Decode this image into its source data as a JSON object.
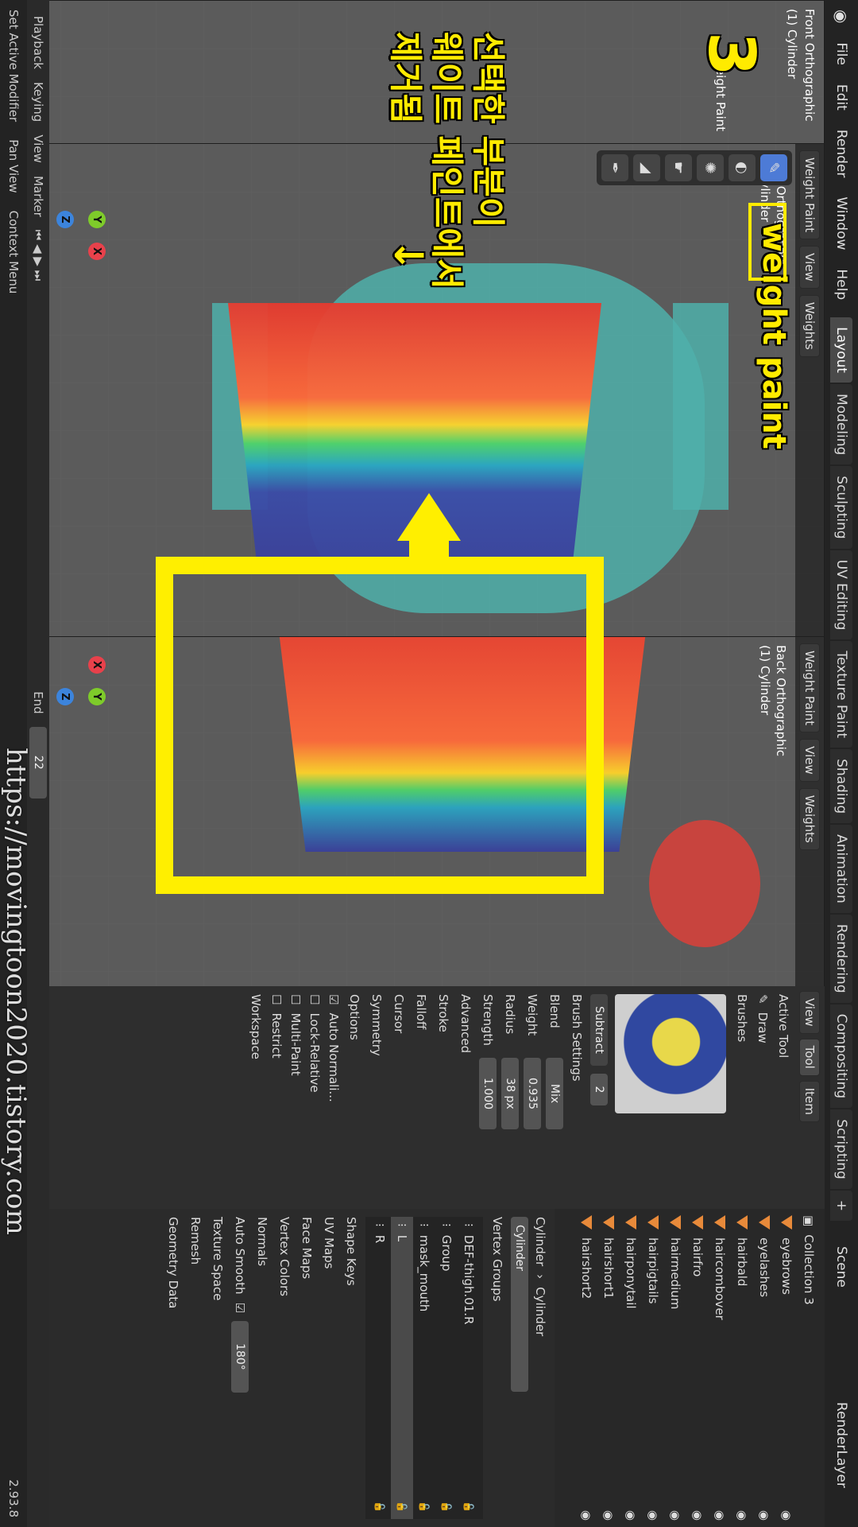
{
  "menu": [
    "File",
    "Edit",
    "Render",
    "Window",
    "Help"
  ],
  "workspaces": [
    "Layout",
    "Modeling",
    "Sculpting",
    "UV Editing",
    "Texture Paint",
    "Shading",
    "Animation",
    "Rendering",
    "Compositing",
    "Scripting"
  ],
  "mode_label": "Weight Paint",
  "view_btn": "View",
  "weights_btn": "Weights",
  "left_view": {
    "title": "Front Orthographic",
    "object": "(1) Cylinder"
  },
  "right_view": {
    "title": "Back Orthographic",
    "object": "(1) Cylinder"
  },
  "axes": {
    "x": "X",
    "y": "Y",
    "z": "Z"
  },
  "annotations": {
    "step": "3",
    "title_en": "weight paint",
    "kr_line1": "선택한 부분이",
    "kr_line2": "웨이트 페인트에서",
    "kr_line3": "제거됨",
    "url": "https://movingtoon2020.tistory.com"
  },
  "tool_panel": {
    "tabs": [
      "View",
      "Tool",
      "Item"
    ],
    "active_tool": "Active Tool",
    "draw": "Draw",
    "brushes": "Brushes",
    "brush_mode": "Subtract",
    "brush_count": "2",
    "brush_settings": "Brush Settings",
    "blend_label": "Blend",
    "blend_value": "Mix",
    "weight_label": "Weight",
    "weight_value": "0.935",
    "radius_label": "Radius",
    "radius_value": "38 px",
    "strength_label": "Strength",
    "strength_value": "1.000",
    "advanced": "Advanced",
    "stroke": "Stroke",
    "falloff": "Falloff",
    "cursor": "Cursor",
    "symmetry": "Symmetry",
    "options": "Options",
    "auto_normalize": "Auto Normali...",
    "lock_relative": "Lock-Relative",
    "multi_paint": "Multi-Paint",
    "restrict": "Restrict",
    "workspace": "Workspace"
  },
  "top_right": {
    "scene": "Scene",
    "render_layer": "RenderLayer"
  },
  "outliner": {
    "collection": "Collection 3",
    "items": [
      "eyebrows",
      "eyelashes",
      "hairbald",
      "haircombover",
      "hairfro",
      "hairmedium",
      "hairpigtails",
      "hairponytail",
      "hairshort1",
      "hairshort2"
    ]
  },
  "properties": {
    "breadcrumb_obj": "Cylinder",
    "breadcrumb_mesh": "Cylinder",
    "mesh_name": "Cylinder",
    "vertex_groups": "Vertex Groups",
    "groups": [
      "DEF-thigh.01.R",
      "Group",
      "mask_mouth",
      "L",
      "R"
    ],
    "shape_keys": "Shape Keys",
    "uv_maps": "UV Maps",
    "face_maps": "Face Maps",
    "vertex_colors": "Vertex Colors",
    "normals": "Normals",
    "auto_smooth": "Auto Smooth",
    "angle": "180°",
    "texture_space": "Texture Space",
    "remesh": "Remesh",
    "geometry_data": "Geometry Data"
  },
  "timeline": {
    "playback": "Playback",
    "keying": "Keying",
    "view": "View",
    "marker": "Marker",
    "end_label": "End",
    "end_value": "22"
  },
  "status": {
    "left": "Set Active Modifier",
    "pan": "Pan View",
    "context": "Context Menu",
    "version": "2.93.8"
  }
}
